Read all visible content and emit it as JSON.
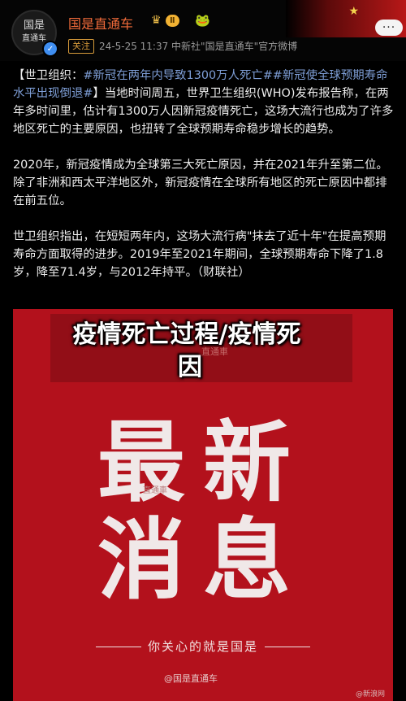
{
  "header": {
    "avatar_line1": "国是",
    "avatar_line2": "直通车",
    "name": "国是直通车",
    "level_badge": "Ⅱ",
    "follow_label": "关注",
    "meta": "24-5-25 11:37  中新社\"国是直通车\"官方微博",
    "more_label": "···"
  },
  "post": {
    "tag_open": "【",
    "tag_prefix": "世卫组织：",
    "hashtag_text": "#新冠在两年内导致1300万人死亡##新冠使全球预期寿命水平出现倒退#",
    "tag_close": "】",
    "p1_rest": "当地时间周五，世界卫生组织(WHO)发布报告称，在两年多时间里，估计有1300万人因新冠疫情死亡，这场大流行也成为了许多地区死亡的主要原因，也扭转了全球预期寿命稳步增长的趋势。",
    "p2": "2020年，新冠疫情成为全球第三大死亡原因，并在2021年升至第二位。除了非洲和西太平洋地区外，新冠疫情在全球所有地区的死亡原因中都排在前五位。",
    "p3": "世卫组织指出，在短短两年内，这场大流行病\"抹去了近十年\"在提高预期寿命方面取得的进步。2019年至2021年期间，全球预期寿命下降了1.8岁，降至71.4岁，与2012年持平。（财联社）"
  },
  "card": {
    "top_text": "直通車",
    "row1": "最新",
    "row2": "消息",
    "car_watermark": "直通車",
    "subtitle": "你关心的就是国是",
    "footer": "@国是直通车",
    "corner_wm": "@新浪网"
  },
  "overlay": {
    "line1": "疫情死亡过程/疫情死",
    "line2": "因"
  }
}
